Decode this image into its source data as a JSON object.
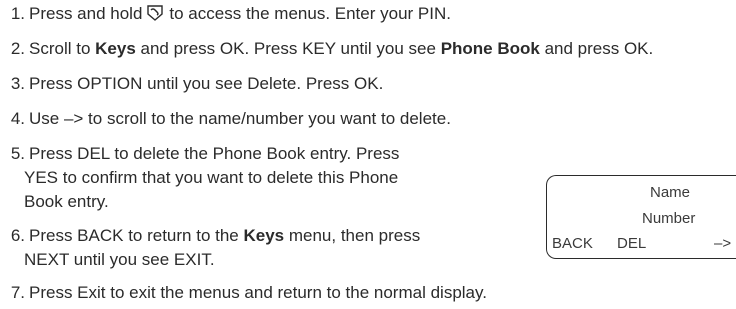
{
  "steps": [
    {
      "num": "1.",
      "before": "Press and hold",
      "icon": "handset-key-icon",
      "after": "to access the menus. Enter your PIN."
    },
    {
      "num": "2.",
      "p1": "Scroll to ",
      "b1": "Keys",
      "p2": " and press OK. Press KEY until you see ",
      "b2": "Phone Book",
      "p3": " and press OK."
    },
    {
      "num": "3.",
      "text": "Press OPTION until you see Delete. Press OK."
    },
    {
      "num": "4.",
      "text": "Use –> to scroll to the name/number you want to delete."
    },
    {
      "num": "5.",
      "line1": "Press DEL to delete the Phone Book entry. Press",
      "line2": "YES to confirm that you want to delete this Phone",
      "line3": "Book entry."
    },
    {
      "num": "6.",
      "p1": "Press BACK to return to the ",
      "b1": "Keys",
      "p2": " menu, then press",
      "line2": "NEXT until you see EXIT."
    },
    {
      "num": "7.",
      "text": "Press Exit to exit the menus and return to the normal display."
    }
  ],
  "display": {
    "line1": "Name",
    "line2": "Number",
    "soft_left": "BACK",
    "soft_mid": "DEL",
    "soft_right": "–>"
  }
}
